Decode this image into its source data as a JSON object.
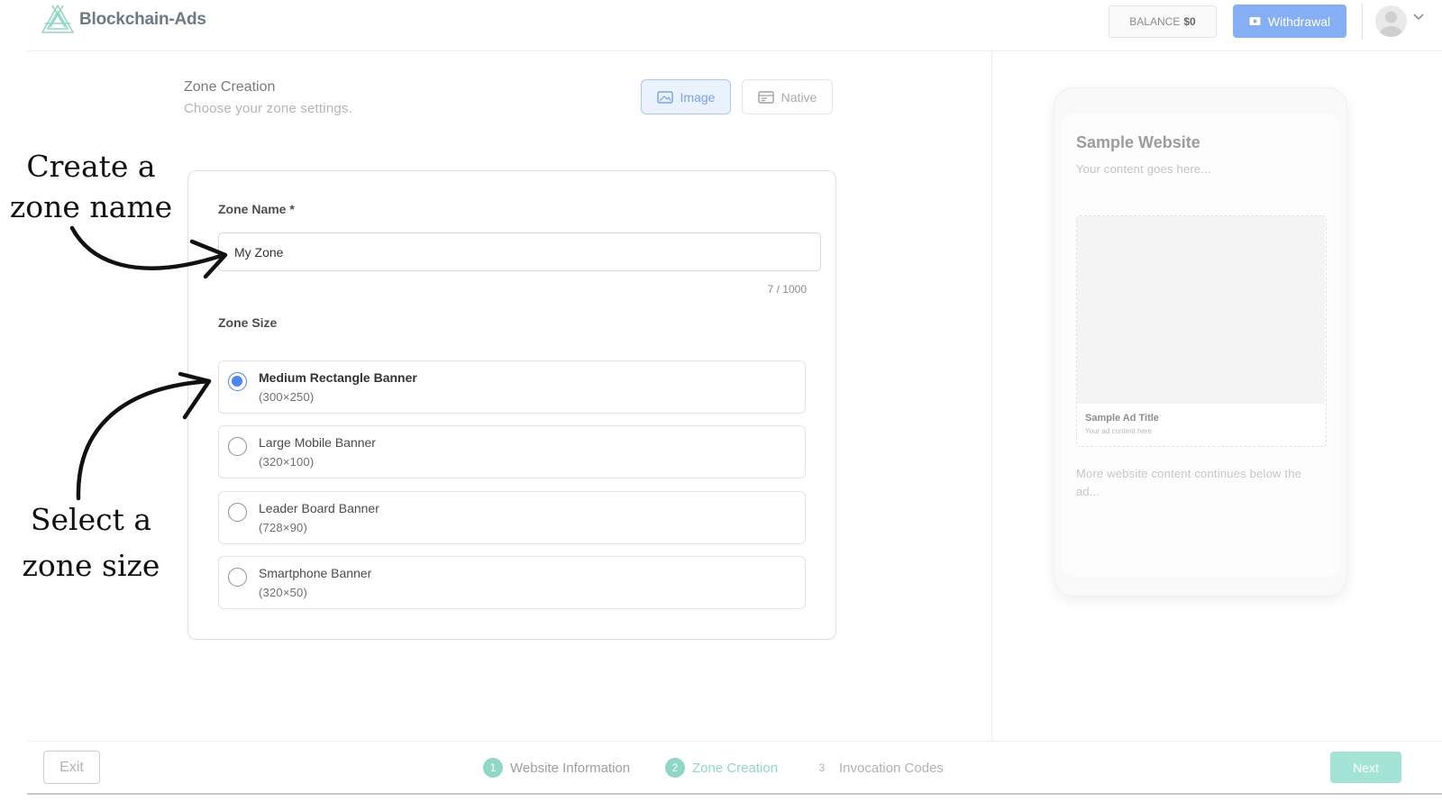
{
  "header": {
    "brand": "Blockchain-Ads",
    "balance_label": "BALANCE",
    "balance_value": "$0",
    "withdraw_label": "Withdrawal"
  },
  "page": {
    "title": "Zone Creation",
    "subtitle": "Choose your zone settings."
  },
  "ad_types": [
    {
      "label": "Image",
      "selected": true
    },
    {
      "label": "Native",
      "selected": false
    }
  ],
  "form": {
    "zone_name_label": "Zone Name *",
    "zone_name_value": "My Zone",
    "char_count": "7 / 1000",
    "zone_size_label": "Zone Size",
    "sizes": [
      {
        "name": "Medium Rectangle Banner",
        "dims": "(300×250)",
        "selected": true
      },
      {
        "name": "Large Mobile Banner",
        "dims": "(320×100)",
        "selected": false
      },
      {
        "name": "Leader Board Banner",
        "dims": "(728×90)",
        "selected": false
      },
      {
        "name": "Smartphone Banner",
        "dims": "(320×50)",
        "selected": false
      }
    ]
  },
  "annotations": {
    "create_line1": "Create a",
    "create_line2": "zone name",
    "select_line1": "Select a",
    "select_line2": "zone size"
  },
  "preview": {
    "site_title": "Sample Website",
    "site_sub": "Your content goes here...",
    "ad_title": "Sample Ad Title",
    "ad_text": "Your ad content here",
    "more_text": "More website content continues below the ad..."
  },
  "footer": {
    "exit_label": "Exit",
    "next_label": "Next",
    "steps": [
      {
        "num": "1",
        "label": "Website Information"
      },
      {
        "num": "2",
        "label": "Zone Creation"
      },
      {
        "num": "3",
        "label": "Invocation Codes"
      }
    ]
  },
  "colors": {
    "accent_blue": "#4c86ef",
    "accent_teal": "#8fd7c6",
    "withdraw_bg": "#86aef4"
  }
}
